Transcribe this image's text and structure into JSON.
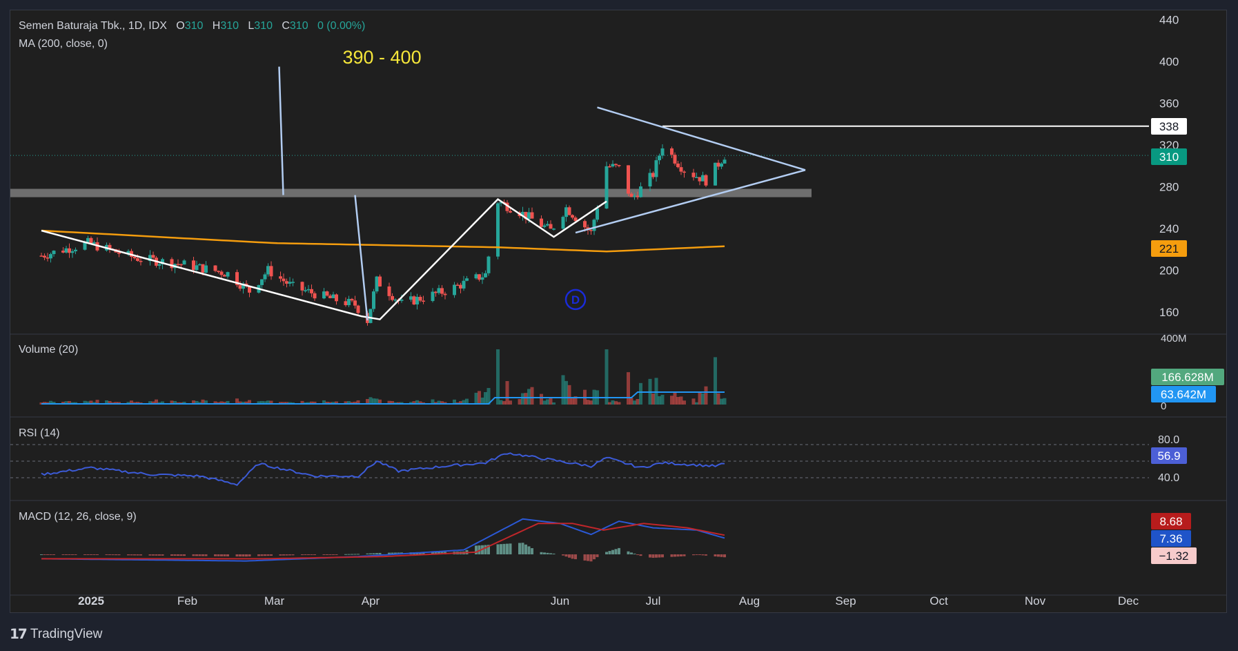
{
  "header": {
    "symbol": "Semen Baturaja Tbk., 1D, IDX",
    "o_label": "O",
    "o_value": "310",
    "h_label": "H",
    "h_value": "310",
    "l_label": "L",
    "l_value": "310",
    "c_label": "C",
    "c_value": "310",
    "change": "0 (0.00%)",
    "ma_label": "MA (200, close, 0)"
  },
  "annotation": {
    "target_text": "390 - 400",
    "dividend_marker": "D"
  },
  "panes": {
    "volume_title": "Volume (20)",
    "rsi_title": "RSI (14)",
    "macd_title": "MACD (12, 26, close, 9)"
  },
  "badges": {
    "resistance": "338",
    "last_price": "310",
    "ma_value": "221",
    "volume": "166.628M",
    "volume_ma": "63.642M",
    "rsi": "56.9",
    "macd_signal": "8.68",
    "macd_line": "7.36",
    "macd_hist": "−1.32"
  },
  "brand": {
    "name": "TradingView"
  },
  "colors": {
    "up": "#26a69a",
    "down": "#ef5350",
    "ma": "#f59d0e",
    "vol_ma": "#2196f3",
    "rsi": "#3c5bd8",
    "macd": "#2b59d6",
    "signal": "#c0262a",
    "annotation": "#f5e63a"
  },
  "chart_data": {
    "type": "candlestick",
    "price_axis": {
      "ticks": [
        160,
        200,
        240,
        280,
        320,
        360,
        400,
        440
      ],
      "range": [
        160,
        440
      ]
    },
    "time_axis": {
      "labels": [
        "2025",
        "Feb",
        "Mar",
        "Apr",
        "Jun",
        "Jul",
        "Aug",
        "Sep",
        "Oct",
        "Nov",
        "Dec"
      ]
    },
    "ohlc_summary": {
      "open": 310,
      "high": 310,
      "low": 310,
      "close": 310
    },
    "price_keypoints": [
      [
        "2024-12-16",
        214
      ],
      [
        "2024-12-31",
        226
      ],
      [
        "2025-01-15",
        212
      ],
      [
        "2025-02-01",
        205
      ],
      [
        "2025-02-14",
        197
      ],
      [
        "2025-02-21",
        180
      ],
      [
        "2025-02-27",
        200
      ],
      [
        "2025-03-07",
        184
      ],
      [
        "2025-03-19",
        173
      ],
      [
        "2025-03-27",
        167
      ],
      [
        "2025-03-31",
        152
      ],
      [
        "2025-04-03",
        190
      ],
      [
        "2025-04-11",
        168
      ],
      [
        "2025-04-25",
        180
      ],
      [
        "2025-05-08",
        196
      ],
      [
        "2025-05-12",
        266
      ],
      [
        "2025-05-19",
        256
      ],
      [
        "2025-05-29",
        238
      ],
      [
        "2025-06-03",
        260
      ],
      [
        "2025-06-11",
        236
      ],
      [
        "2025-06-16",
        300
      ],
      [
        "2025-06-20",
        298
      ],
      [
        "2025-06-24",
        268
      ],
      [
        "2025-07-01",
        292
      ],
      [
        "2025-07-04",
        320
      ],
      [
        "2025-07-11",
        296
      ],
      [
        "2025-07-18",
        286
      ],
      [
        "2025-07-24",
        310
      ]
    ],
    "ma200_keypoints": [
      [
        "2024-12-16",
        238
      ],
      [
        "2025-03-01",
        226
      ],
      [
        "2025-05-12",
        222
      ],
      [
        "2025-06-16",
        218
      ],
      [
        "2025-07-24",
        223
      ]
    ],
    "volume_axis": {
      "ticks": [
        "0",
        "400M"
      ]
    },
    "volume_last": 166.628,
    "volume_ma_last": 63.642,
    "rsi_axis": {
      "ticks": [
        40,
        80
      ]
    },
    "rsi_keypoints": [
      [
        "2024-12-16",
        44
      ],
      [
        "2025-01-01",
        52
      ],
      [
        "2025-01-20",
        44
      ],
      [
        "2025-02-05",
        42
      ],
      [
        "2025-02-17",
        32
      ],
      [
        "2025-02-24",
        57
      ],
      [
        "2025-03-14",
        42
      ],
      [
        "2025-03-28",
        42
      ],
      [
        "2025-04-03",
        60
      ],
      [
        "2025-04-10",
        48
      ],
      [
        "2025-04-25",
        54
      ],
      [
        "2025-05-08",
        58
      ],
      [
        "2025-05-15",
        70
      ],
      [
        "2025-06-04",
        58
      ],
      [
        "2025-06-11",
        54
      ],
      [
        "2025-06-16",
        64
      ],
      [
        "2025-06-27",
        52
      ],
      [
        "2025-07-04",
        58
      ],
      [
        "2025-07-21",
        54
      ],
      [
        "2025-07-24",
        56.9
      ]
    ],
    "macd": {
      "signal_last": 8.68,
      "macd_last": 7.36,
      "hist_last": -1.32
    },
    "drawings": {
      "resistance_level": 338,
      "support_zone": [
        270,
        278
      ],
      "target_range": [
        390,
        400
      ]
    }
  }
}
